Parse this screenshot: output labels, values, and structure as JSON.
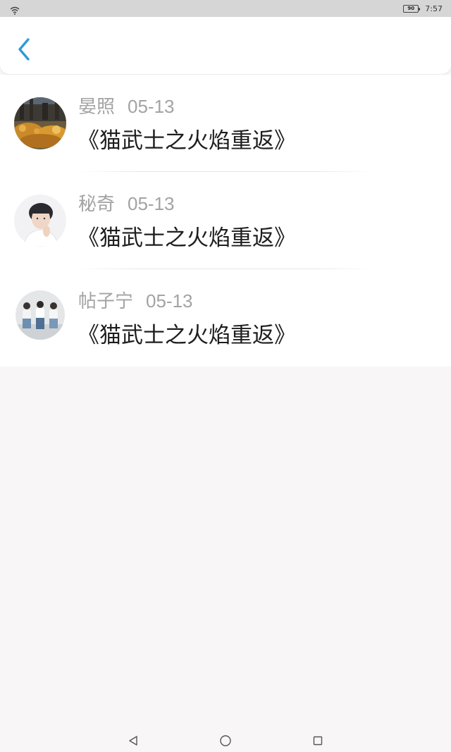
{
  "status_bar": {
    "battery": "90",
    "time": "7:57",
    "icons": [
      "wifi-icon",
      "battery-icon"
    ]
  },
  "header": {
    "back_icon": "chevron-left-icon",
    "accent_color": "#2e9bd6"
  },
  "items": [
    {
      "name": "晏照",
      "date": "05-13",
      "title": "《猫武士之火焰重返》",
      "avatar": "autumn-scene-photo"
    },
    {
      "name": "秘奇",
      "date": "05-13",
      "title": "《猫武士之火焰重返》",
      "avatar": "portrait-photo"
    },
    {
      "name": "帖子宁",
      "date": "05-13",
      "title": "《猫武士之火焰重返》",
      "avatar": "group-photo"
    }
  ],
  "nav_bar": {
    "icons": [
      "back-triangle-icon",
      "home-circle-icon",
      "recents-square-icon"
    ]
  }
}
